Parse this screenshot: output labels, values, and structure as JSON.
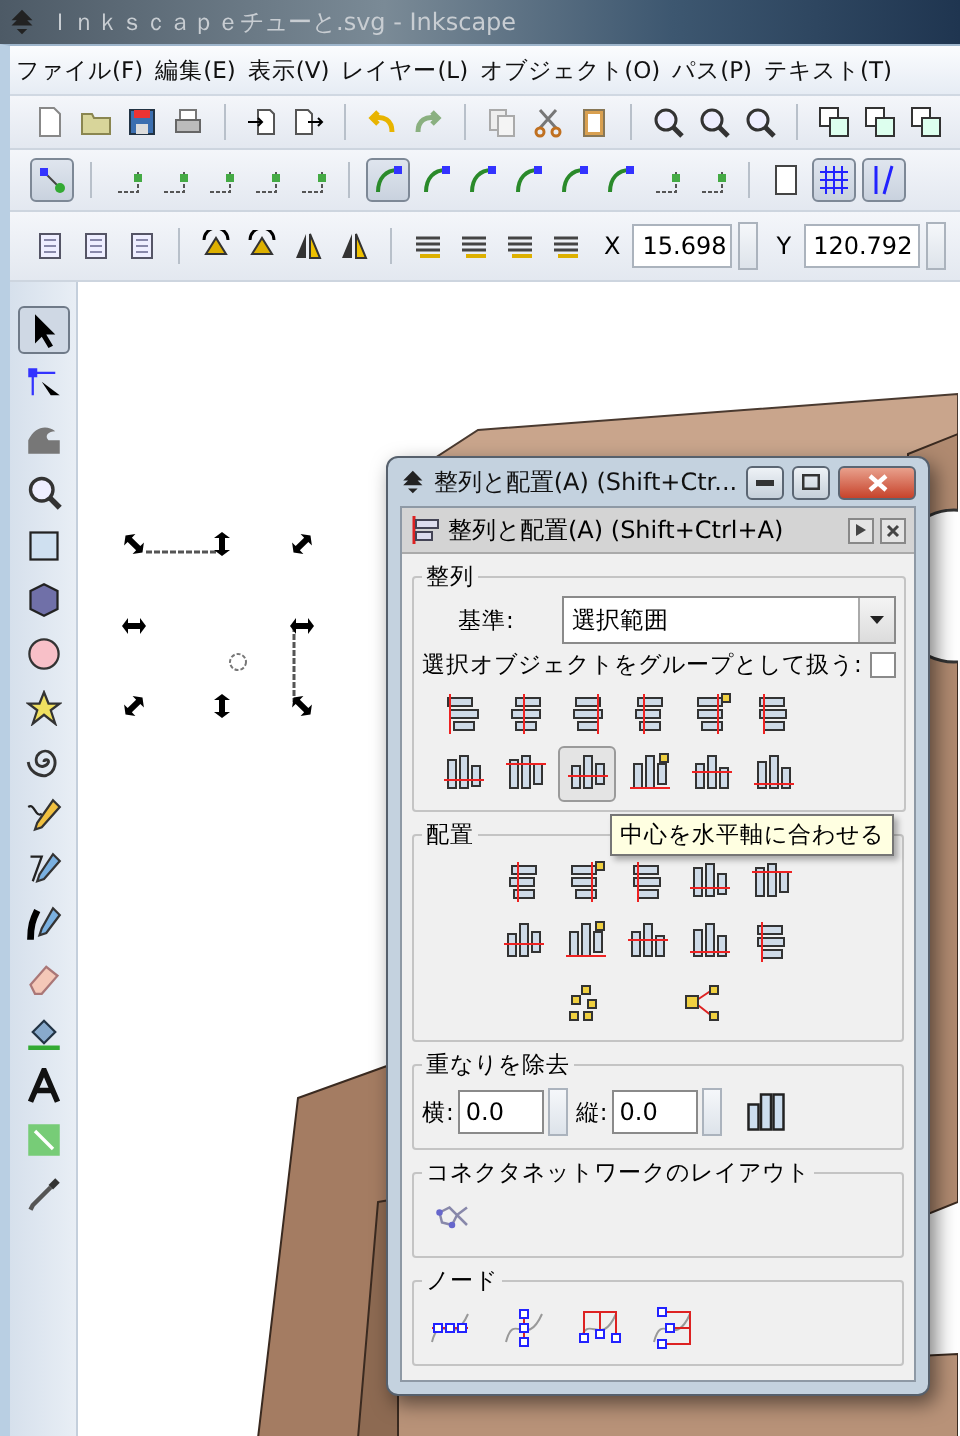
{
  "window": {
    "title": "Ｉｎｋｓｃａｐｅチューと.svg - Inkscape"
  },
  "menu": [
    "ファイル(F)",
    "編集(E)",
    "表示(V)",
    "レイヤー(L)",
    "オブジェクト(O)",
    "パス(P)",
    "テキスト(T)"
  ],
  "snap_toolbar": [
    {
      "pressed": true
    },
    {
      "pressed": false
    },
    {
      "pressed": false
    },
    {
      "pressed": false
    },
    {
      "pressed": false
    },
    {
      "pressed": false
    },
    {
      "pressed": true
    },
    {
      "pressed": false
    },
    {
      "pressed": false
    },
    {
      "pressed": false
    },
    {
      "pressed": false
    },
    {
      "pressed": false
    },
    {
      "pressed": false
    },
    {
      "pressed": false
    },
    {
      "pressed": false
    },
    {
      "pressed": true
    },
    {
      "pressed": true
    }
  ],
  "coords": [
    {
      "label": "X",
      "value": "15.698"
    },
    {
      "label": "Y",
      "value": "120.792"
    }
  ],
  "toolbox": [
    {
      "pressed": true
    },
    {
      "pressed": false
    },
    {
      "pressed": false
    },
    {
      "pressed": false
    },
    {
      "pressed": false
    },
    {
      "pressed": false
    },
    {
      "pressed": false
    },
    {
      "pressed": false
    },
    {
      "pressed": false
    },
    {
      "pressed": false
    },
    {
      "pressed": false
    },
    {
      "pressed": false
    },
    {
      "pressed": false
    },
    {
      "pressed": false
    },
    {
      "pressed": false
    },
    {
      "pressed": false
    },
    {
      "pressed": false
    }
  ],
  "dialog": {
    "title": "整列と配置(A) (Shift+Ctr...",
    "panel_title": "整列と配置(A) (Shift+Ctrl+A)",
    "align": {
      "legend": "整列",
      "relative_label": "基準:",
      "relative_value": "選択範囲",
      "group_label": "選択オブジェクトをグループとして扱う:",
      "group_checked": false,
      "buttons": [
        {
          "hovered": false
        },
        {
          "hovered": false
        },
        {
          "hovered": false
        },
        {
          "hovered": false
        },
        {
          "hovered": false
        },
        {
          "hovered": false
        },
        {
          "hovered": false
        },
        {
          "hovered": false
        },
        {
          "hovered": true
        },
        {
          "hovered": false
        },
        {
          "hovered": false
        },
        {
          "hovered": false
        }
      ]
    },
    "tooltip": "中心を水平軸に合わせる",
    "distribute": {
      "legend": "配置"
    },
    "overlap": {
      "legend": "重なりを除去",
      "h_label": "横:",
      "h_value": "0.0",
      "v_label": "縦:",
      "v_value": "0.0"
    },
    "connector": {
      "legend": "コネクタネットワークのレイアウト"
    },
    "nodes": {
      "legend": "ノード"
    }
  }
}
